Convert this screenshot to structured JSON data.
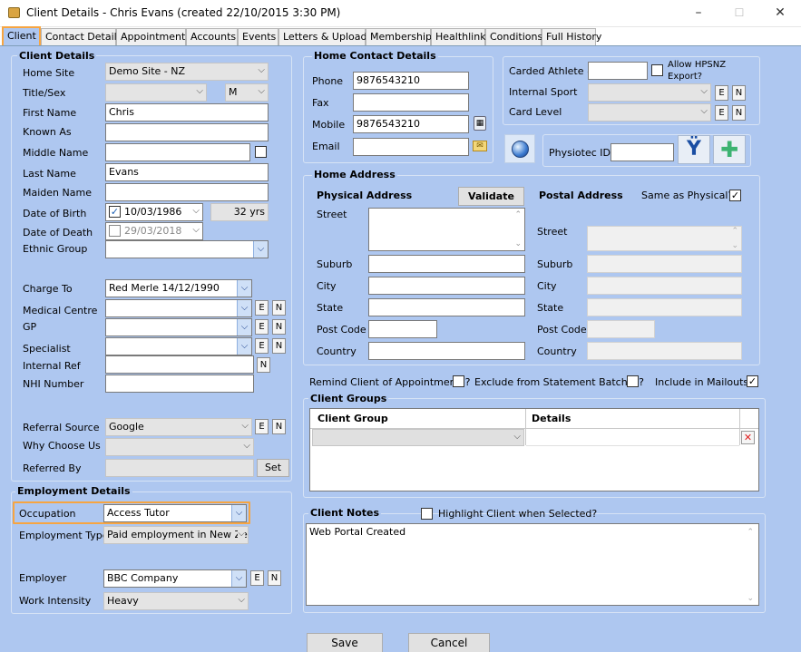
{
  "window": {
    "title": "Client Details - Chris Evans (created 22/10/2015 3:30 PM)",
    "min": "–",
    "max": "☐",
    "close": "✕"
  },
  "tabs": [
    "Client",
    "Contact Details",
    "Appointments",
    "Accounts",
    "Events",
    "Letters & Uploads",
    "Memberships",
    "Healthlink",
    "Conditions",
    "Full History"
  ],
  "client_details": {
    "title": "Client Details",
    "home_site_label": "Home Site",
    "home_site": "Demo Site - NZ",
    "title_sex_label": "Title/Sex",
    "sex": "M",
    "first_name_label": "First Name",
    "first_name": "Chris",
    "known_as_label": "Known As",
    "middle_name_label": "Middle Name",
    "last_name_label": "Last Name",
    "last_name": "Evans",
    "maiden_name_label": "Maiden Name",
    "dob_label": "Date of Birth",
    "dob": "10/03/1986",
    "age": "32 yrs",
    "dod_label": "Date of Death",
    "dod": "29/03/2018",
    "ethnic_label": "Ethnic Group",
    "charge_to_label": "Charge To",
    "charge_to": "Red Merle 14/12/1990",
    "medical_centre_label": "Medical Centre",
    "gp_label": "GP",
    "specialist_label": "Specialist",
    "internal_ref_label": "Internal Ref",
    "nhi_label": "NHI Number",
    "referral_label": "Referral Source",
    "referral": "Google",
    "why_label": "Why Choose Us",
    "referred_by_label": "Referred By",
    "set_label": "Set",
    "e": "E",
    "n": "N"
  },
  "employment": {
    "title": "Employment Details",
    "occupation_label": "Occupation",
    "occupation": "Access Tutor",
    "type_label": "Employment Type",
    "type": "Paid employment in New Zea",
    "employer_label": "Employer",
    "employer": "BBC Company",
    "intensity_label": "Work Intensity",
    "intensity": "Heavy"
  },
  "home_contact": {
    "title": "Home Contact Details",
    "phone_label": "Phone",
    "phone": "9876543210",
    "fax_label": "Fax",
    "mobile_label": "Mobile",
    "mobile": "9876543210",
    "email_label": "Email"
  },
  "carded": {
    "athlete_label": "Carded Athlete #",
    "hpsnz_label1": "Allow HPSNZ",
    "hpsnz_label2": "Export?",
    "sport_label": "Internal Sport",
    "card_label": "Card Level",
    "physiotec_label": "Physiotec ID"
  },
  "home_address": {
    "title": "Home Address",
    "physical_title": "Physical Address",
    "validate_label": "Validate",
    "postal_title": "Postal Address",
    "same_label": "Same as Physical?",
    "street": "Street",
    "suburb": "Suburb",
    "city": "City",
    "state": "State",
    "postcode": "Post Code",
    "country": "Country"
  },
  "options": {
    "remind_label": "Remind Client of Appointments?",
    "exclude_label": "Exclude from Statement Batches?",
    "mailouts_label": "Include in Mailouts?"
  },
  "client_groups": {
    "title": "Client Groups",
    "col_group": "Client Group",
    "col_details": "Details"
  },
  "notes": {
    "title": "Client Notes",
    "highlight_label": "Highlight Client when Selected?",
    "text": "Web Portal Created"
  },
  "footer": {
    "save": "Save",
    "cancel": "Cancel"
  },
  "colors": {
    "background": "#aec7f0",
    "highlight": "#f7a541"
  }
}
